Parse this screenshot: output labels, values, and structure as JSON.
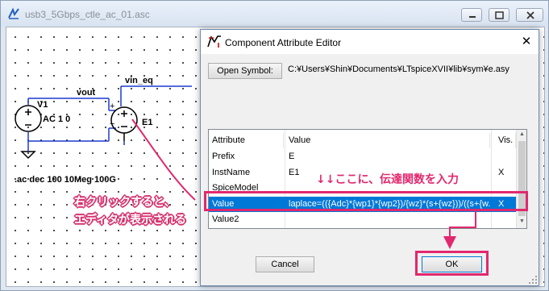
{
  "window": {
    "title": "usb3_5Gbps_ctle_ac_01.asc"
  },
  "schematic": {
    "labels": {
      "vout": "vout",
      "vin_eq": "vin_eq",
      "v1": "V1",
      "v1_value": "AC 1 0",
      "e1": "E1",
      "directive": ".ac dec 100 10Meg 100G",
      "plus": "+",
      "minus": "−",
      "plus2": "+",
      "minus2": "−"
    }
  },
  "dialog": {
    "title": "Component Attribute Editor",
    "close_glyph": "✕",
    "open_symbol_label": "Open Symbol:",
    "symbol_path": "C:¥Users¥Shin¥Documents¥LTspiceXVII¥lib¥sym¥e.asy",
    "table": {
      "headers": [
        "Attribute",
        "Value",
        "Vis."
      ],
      "rows": [
        {
          "attribute": "Prefix",
          "value": "E",
          "vis": ""
        },
        {
          "attribute": "InstName",
          "value": "E1",
          "vis": "X"
        },
        {
          "attribute": "SpiceModel",
          "value": "",
          "vis": ""
        },
        {
          "attribute": "Value",
          "value": "laplace=(({Adc}*{wp1}*{wp2})/{wz}*(s+{wz}))/((s+{w...",
          "vis": "X"
        },
        {
          "attribute": "Value2",
          "value": "",
          "vis": ""
        }
      ],
      "selected_row": 3
    },
    "cancel_label": "Cancel",
    "ok_label": "OK"
  },
  "annotations": {
    "right_click_line1": "右クリックすると、",
    "right_click_line2": "エディタが表示される",
    "insert_here": "↓↓ここに、伝達関数を入力"
  },
  "colors": {
    "accent_pink": "#e2286e",
    "selection_blue": "#0078d7"
  }
}
